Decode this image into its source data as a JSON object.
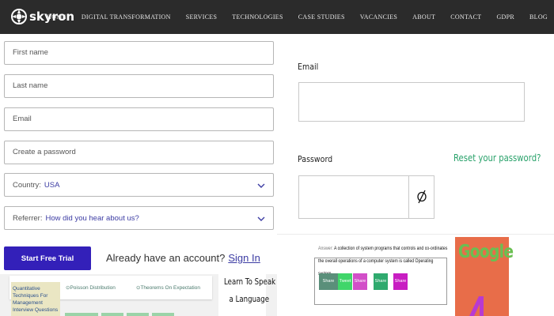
{
  "brand": {
    "name": "skyron"
  },
  "nav": [
    "HOME",
    "DIGITAL TRANSFORMATION",
    "SERVICES",
    "TECHNOLOGIES",
    "CASE STUDIES",
    "VACANCIES",
    "ABOUT",
    "CONTACT",
    "GDPR",
    "BLOG"
  ],
  "signup": {
    "first_name_placeholder": "First name",
    "last_name_placeholder": "Last name",
    "email_placeholder": "Email",
    "password_placeholder": "Create a password",
    "country_label": "Country:",
    "country_value": "USA",
    "referrer_label": "Referrer:",
    "referrer_value": "How did you hear about us?",
    "start_button": "Start Free Trial",
    "have_account": "Already have an account?",
    "sign_in": "Sign In"
  },
  "login": {
    "email_label": "Email",
    "password_label": "Password",
    "reset_link": "Reset your password?"
  },
  "bottom_left": {
    "blog_thumb": "Quantitative Techniques For Management Interview Questions",
    "tag_1": "Poisson Distribution",
    "tag_2": "Theorems On Expectation",
    "learn_line_1": "Learn To Speak",
    "learn_line_2": "a Language"
  },
  "bottom_right": {
    "answer_prefix": "Answer:",
    "answer_text": "A collection of system programs that controls and co-ordinates the overall operations of a computer system is called Operating system.",
    "share_buttons": [
      "Share",
      "Tweet",
      "Share",
      "Share",
      "Share"
    ],
    "google_text": "Google"
  },
  "colors": {
    "topbar": "#2b2b2b",
    "primary_button": "#3320b9",
    "link": "#3c3ca3",
    "reset_link": "#2aa26b"
  }
}
